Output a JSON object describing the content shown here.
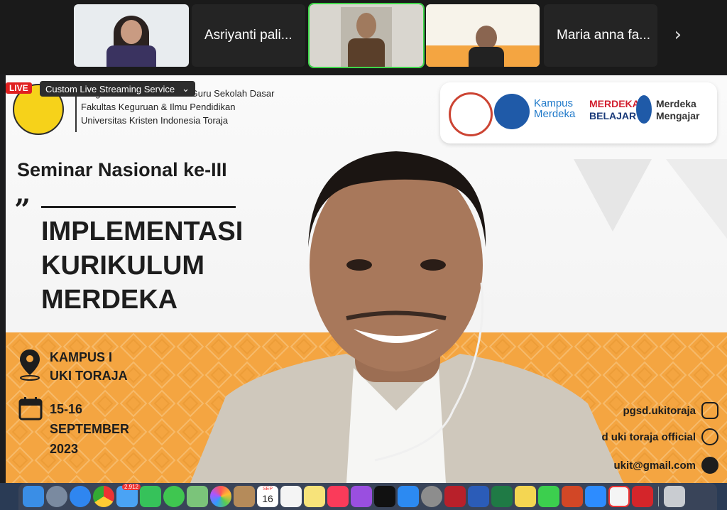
{
  "participants": [
    {
      "kind": "video",
      "name": ""
    },
    {
      "kind": "name",
      "name": "Asriyanti pali..."
    },
    {
      "kind": "video",
      "name": "",
      "active": true
    },
    {
      "kind": "video",
      "name": ""
    },
    {
      "kind": "name",
      "name": "Maria anna fa..."
    }
  ],
  "strip": {
    "next_icon": "chevron-right-icon"
  },
  "stream": {
    "live_label": "LIVE",
    "service_label": "Custom Live Streaming Service",
    "chevron": "⌄"
  },
  "slide": {
    "institution": {
      "line1": "Program Studi Pendidikan Guru Sekolah Dasar",
      "line2": "Fakultas Keguruan & Ilmu Pendidikan",
      "line3": "Universitas Kristen Indonesia Toraja"
    },
    "partner_logos": {
      "kampus_merdeka": "Kampus Merdeka",
      "merdeka_belajar_1": "MERDEKA",
      "merdeka_belajar_2": "BELAJAR",
      "merdeka_mengajar_1": "Merdeka",
      "merdeka_mengajar_2": "Mengajar"
    },
    "seminar_title": "Seminar Nasional ke-III",
    "quote_mark": "”",
    "headline": [
      "IMPLEMENTASI",
      "KURIKULUM",
      "MERDEKA"
    ],
    "location": [
      "KAMPUS I",
      "UKI TORAJA"
    ],
    "date": [
      "15-16",
      "SEPTEMBER",
      "2023"
    ],
    "socials": [
      {
        "text": "pgsd.ukitoraja",
        "icon": "instagram-icon"
      },
      {
        "text": "d uki toraja official",
        "icon": "youtube-icon"
      },
      {
        "text": "ukit@gmail.com",
        "icon": "email-icon"
      }
    ]
  },
  "dock": {
    "calendar_month": "SEP",
    "calendar_day": "16",
    "mail_badge": "2,912",
    "apps": [
      "finder",
      "launchpad",
      "safari",
      "chrome",
      "mail",
      "facetime",
      "messages",
      "maps",
      "photos",
      "contacts",
      "calendar",
      "reminders",
      "notes",
      "music",
      "podcasts",
      "tv",
      "app-store",
      "system-settings",
      "photo-booth",
      "word",
      "excel",
      "stickies",
      "whatsapp",
      "powerpoint",
      "zoom",
      "wps",
      "acrobat",
      "trash"
    ]
  },
  "colors": {
    "accent_orange": "#f4a541",
    "live_red": "#e02020",
    "active_green": "#3fd64a"
  }
}
